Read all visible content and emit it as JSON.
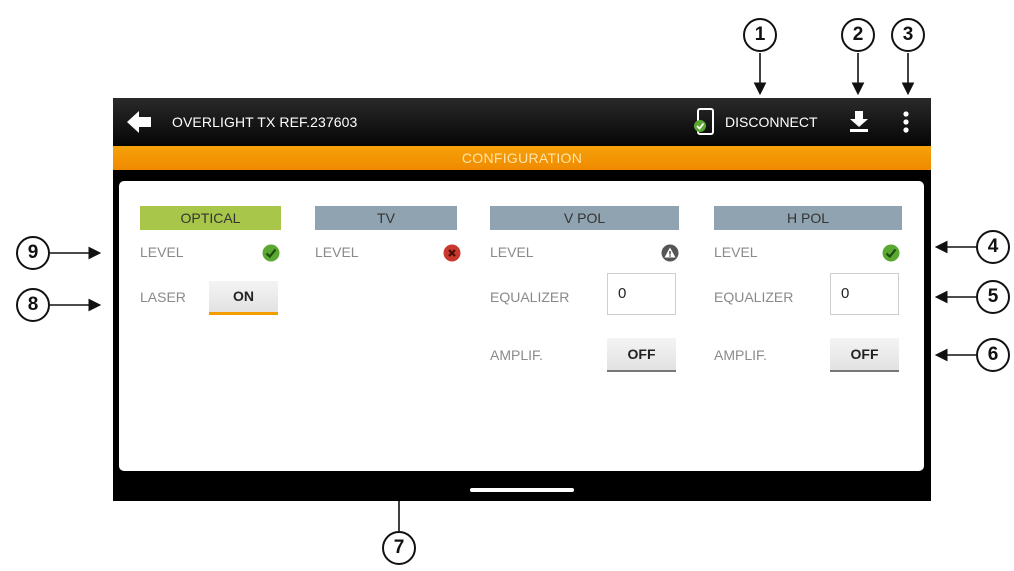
{
  "callouts": [
    "1",
    "2",
    "3",
    "4",
    "5",
    "6",
    "7",
    "8",
    "9"
  ],
  "topbar": {
    "title": "OVERLIGHT TX REF.237603",
    "disconnect_label": "DISCONNECT",
    "icons": [
      "back-arrow-icon",
      "phone-connected-icon",
      "download-icon",
      "more-vert-icon"
    ]
  },
  "config_title": "CONFIGURATION",
  "columns": {
    "optical": {
      "header": "OPTICAL",
      "level_label": "LEVEL",
      "level_status": "ok",
      "laser_label": "LASER",
      "laser_value": "ON"
    },
    "tv": {
      "header": "TV",
      "level_label": "LEVEL",
      "level_status": "error"
    },
    "vpol": {
      "header": "V POL",
      "level_label": "LEVEL",
      "level_status": "warning",
      "equalizer_label": "EQUALIZER",
      "equalizer_value": "0",
      "amplif_label": "AMPLIF.",
      "amplif_value": "OFF"
    },
    "hpol": {
      "header": "H POL",
      "level_label": "LEVEL",
      "level_status": "ok",
      "equalizer_label": "EQUALIZER",
      "equalizer_value": "0",
      "amplif_label": "AMPLIF.",
      "amplif_value": "OFF"
    }
  },
  "colors": {
    "optical_header": "#a8c64a",
    "column_header": "#8fa3b1",
    "accent": "#f59c00",
    "ok": "#5aa832",
    "error": "#c9382c",
    "warning": "#555555"
  }
}
